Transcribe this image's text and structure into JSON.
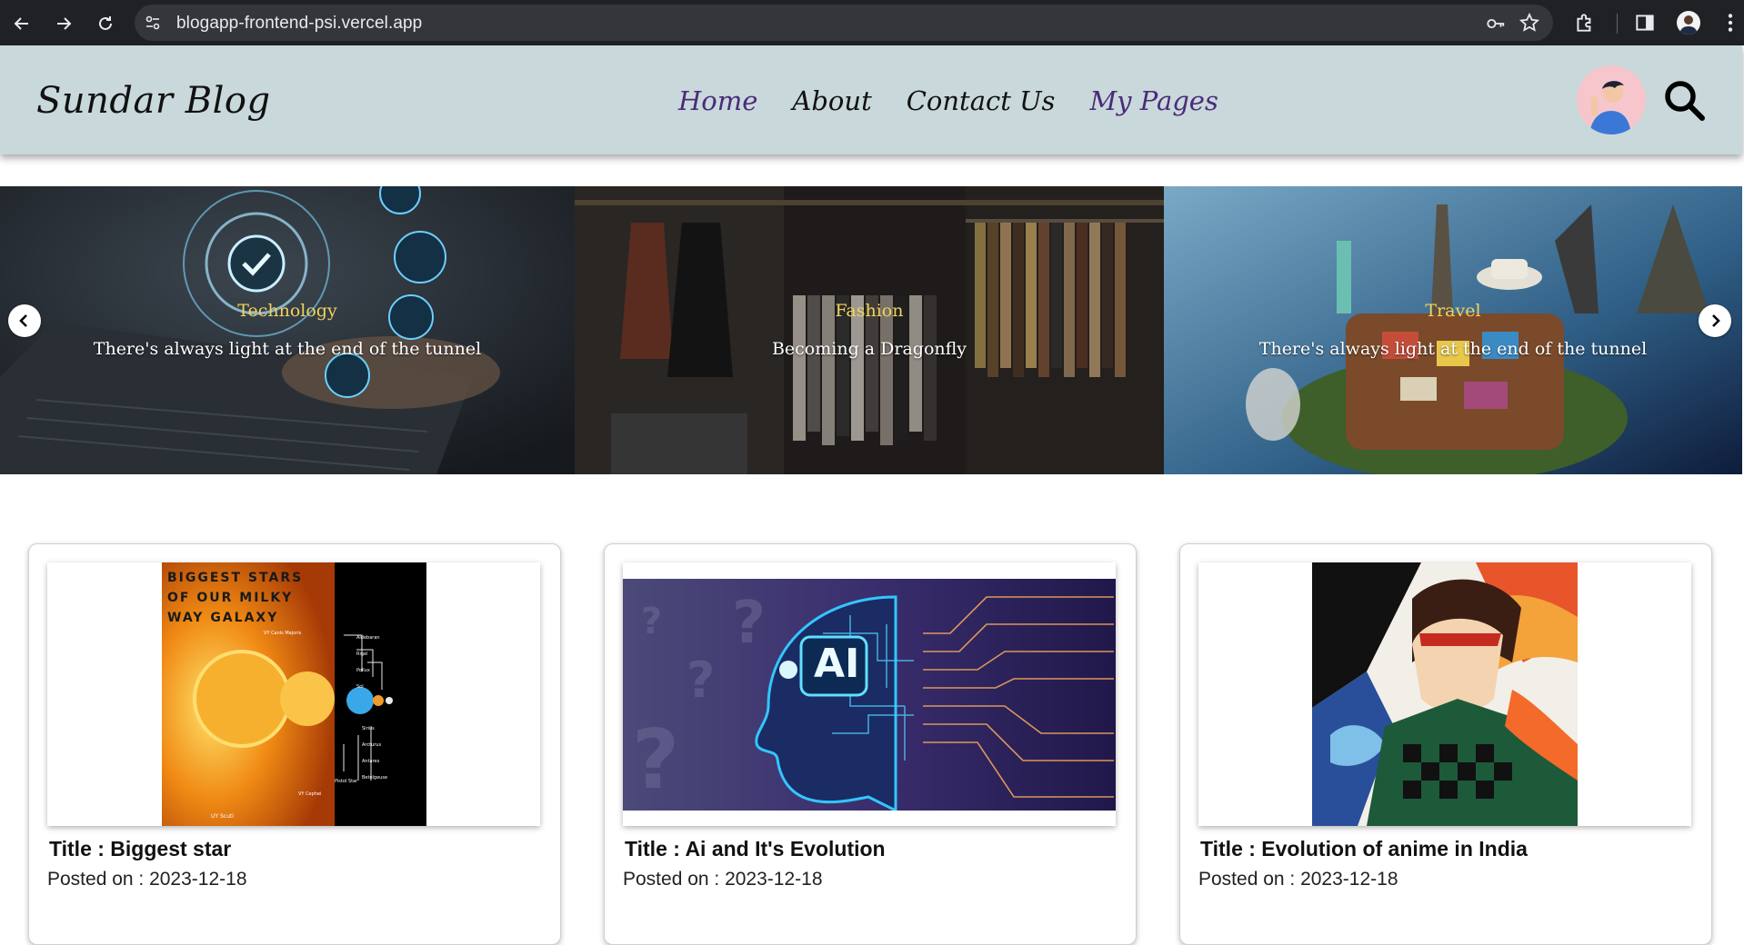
{
  "browser": {
    "url": "blogapp-frontend-psi.vercel.app"
  },
  "header": {
    "logo": "Sundar Blog",
    "nav": [
      {
        "label": "Home"
      },
      {
        "label": "About"
      },
      {
        "label": "Contact Us"
      },
      {
        "label": "My Pages"
      }
    ]
  },
  "carousel": {
    "slides": [
      {
        "category": "Technology",
        "caption": "There's always light at the end of the tunnel"
      },
      {
        "category": "Fashion",
        "caption": "Becoming a Dragonfly"
      },
      {
        "category": "Travel",
        "caption": "There's always light at the end of the tunnel"
      }
    ]
  },
  "posts": [
    {
      "title": "Title : Biggest star",
      "posted": "Posted on : 2023-12-18",
      "image_text": [
        "BIGGEST STARS",
        "OF OUR MILKY",
        "WAY GALAXY"
      ],
      "image_labels": [
        "VY Canis Majoris",
        "Aldebaran",
        "Rigel",
        "Pollux",
        "Sol",
        "Sirius",
        "Arcturus",
        "Antares",
        "Betelgeuse",
        "Pistol Star",
        "VY Cephei",
        "UY Scuti"
      ]
    },
    {
      "title": "Title : Ai and It's Evolution",
      "posted": "Posted on : 2023-12-18",
      "image_text": [
        "AI"
      ]
    },
    {
      "title": "Title : Evolution of anime in India",
      "posted": "Posted on : 2023-12-18"
    }
  ],
  "colors": {
    "header_bg": "#c9d8da",
    "nav_active": "#4a2b7a",
    "caption_category": "#f1d35c",
    "chrome_bg": "#202124"
  }
}
